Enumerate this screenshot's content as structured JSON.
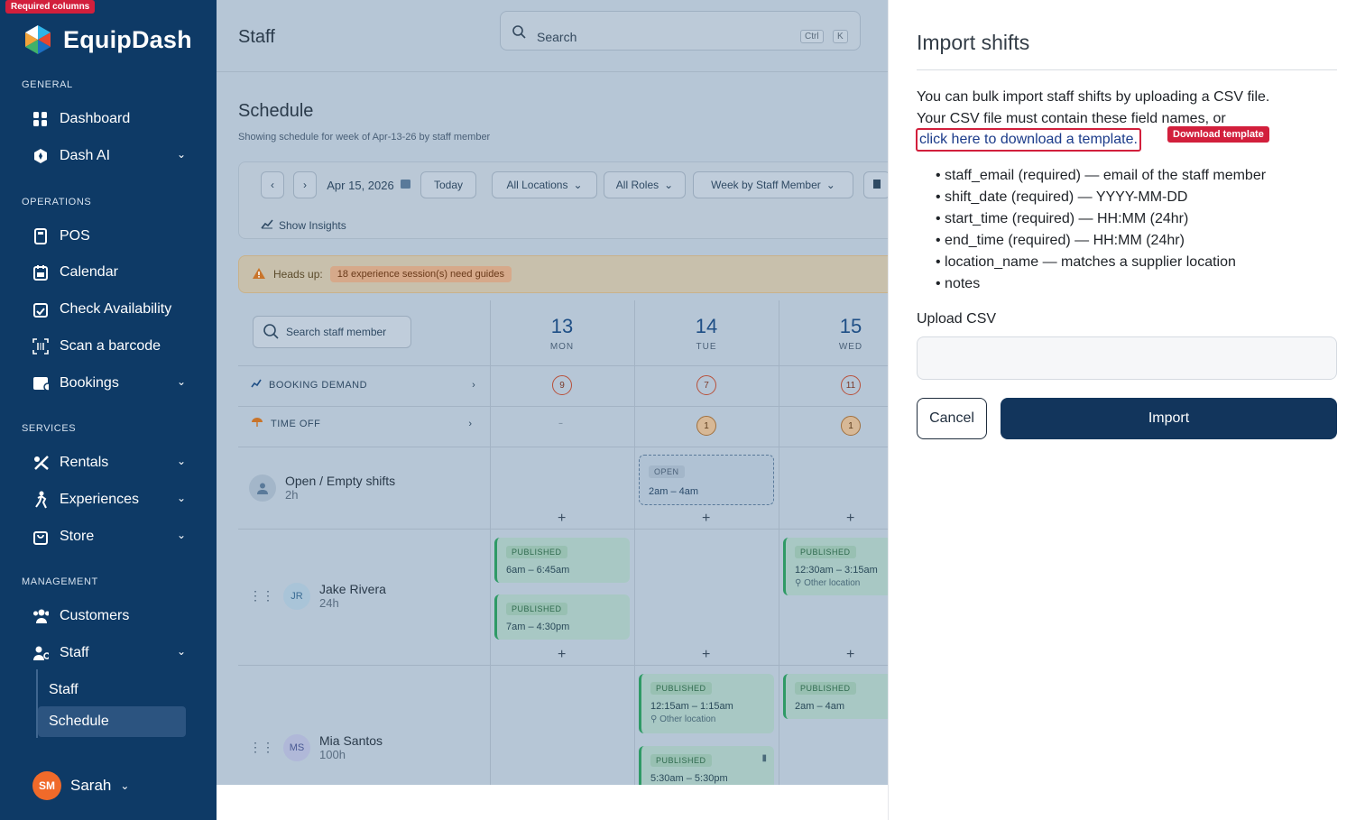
{
  "annotations": {
    "required_columns": "Required columns",
    "download_template": "Download template"
  },
  "brand": {
    "name": "EquipDash"
  },
  "sidebar": {
    "sections": [
      "GENERAL",
      "OPERATIONS",
      "SERVICES",
      "MANAGEMENT"
    ],
    "items": [
      {
        "label": "Dashboard",
        "icon": "grid-icon"
      },
      {
        "label": "Dash AI",
        "icon": "ai-hexagon-icon"
      },
      {
        "label": "POS",
        "icon": "pos-terminal-icon"
      },
      {
        "label": "Calendar",
        "icon": "calendar-icon"
      },
      {
        "label": "Check Availability",
        "icon": "calendar-check-icon"
      },
      {
        "label": "Scan a barcode",
        "icon": "barcode-scan-icon"
      },
      {
        "label": "Bookings",
        "icon": "bookings-icon"
      },
      {
        "label": "Rentals",
        "icon": "rentals-icon"
      },
      {
        "label": "Experiences",
        "icon": "experiences-icon"
      },
      {
        "label": "Store",
        "icon": "store-icon"
      },
      {
        "label": "Customers",
        "icon": "customers-icon"
      },
      {
        "label": "Staff",
        "icon": "staff-icon"
      }
    ],
    "sub_items": [
      "Staff",
      "Schedule"
    ],
    "user": {
      "initials": "SM",
      "name": "Sarah"
    }
  },
  "header": {
    "title": "Staff",
    "search_placeholder": "Search",
    "kbd": [
      "Ctrl",
      "K"
    ]
  },
  "schedule": {
    "title": "Schedule",
    "subtitle": "Showing schedule for week of Apr-13-26 by staff member",
    "date": "Apr 15, 2026",
    "today": "Today",
    "filters": [
      "All Locations",
      "All Roles",
      "Week by Staff Member"
    ],
    "insights": "Show Insights",
    "heads_up": "Heads up:",
    "heads_up_badge": "18 experience session(s) need guides",
    "staff_search": "Search staff member",
    "days": [
      {
        "num": "13",
        "name": "MON"
      },
      {
        "num": "14",
        "name": "TUE"
      },
      {
        "num": "15",
        "name": "WED"
      }
    ],
    "booking_demand": {
      "label": "BOOKING DEMAND",
      "counts": [
        "9",
        "7",
        "11"
      ]
    },
    "time_off": {
      "label": "TIME OFF",
      "counts": [
        "–",
        "1",
        "1"
      ]
    },
    "open_row": {
      "name": "Open / Empty shifts",
      "hours": "2h",
      "tag": "OPEN",
      "time": "2am – 4am"
    },
    "staff": [
      {
        "initials": "JR",
        "name": "Jake Rivera",
        "hours": "24h"
      },
      {
        "initials": "MS",
        "name": "Mia Santos",
        "hours": "100h"
      }
    ],
    "shift_tag": "PUBLISHED",
    "shifts": {
      "jr_mon_1": "6am – 6:45am",
      "jr_mon_2": "7am – 4:30pm",
      "jr_wed_1": "12:30am – 3:15am",
      "ms_tue_1": "12:15am – 1:15am",
      "ms_tue_2": "5:30am – 5:30pm",
      "ms_wed_1": "2am – 4am"
    },
    "other_location": "Other location"
  },
  "panel": {
    "title": "Import shifts",
    "text_line1": "You can bulk import staff shifts by uploading a CSV file.",
    "text_line2": "Your CSV file must contain these field names, or",
    "link": "click here to download a template.",
    "fields": [
      "staff_email (required) — email of the staff member",
      "shift_date (required) — YYYY-MM-DD",
      "start_time (required) — HH:MM (24hr)",
      "end_time (required) — HH:MM (24hr)",
      "location_name — matches a supplier location",
      "notes"
    ],
    "upload_label": "Upload CSV",
    "cancel": "Cancel",
    "import": "Import"
  }
}
